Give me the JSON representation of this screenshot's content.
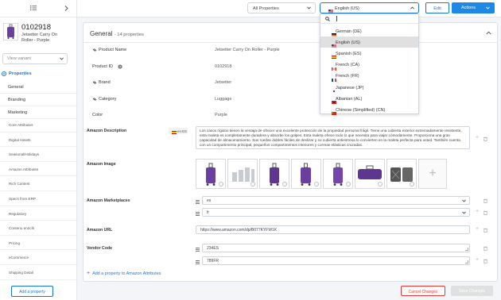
{
  "product": {
    "id": "0102918",
    "name": "Jetsetter Carry On Roller - Purple"
  },
  "sidebar": {
    "variant_placeholder": "View variant",
    "properties_heading": "Properties",
    "groups": [
      "General",
      "Branding",
      "Marketing"
    ],
    "subitems": [
      "Core Attributes",
      "Digital Assets",
      "Seasonal/Holidays",
      "Amazon Attributes",
      "Rich Content",
      "Specs from ERP",
      "Regulatory",
      "Contenu enrichi",
      "Pricing",
      "eCommerce",
      "Shipping Detail"
    ],
    "add_property_label": "Add a property"
  },
  "topbar": {
    "properties_filter": "All Properties",
    "language_selected": "English (US)",
    "edit_label": "Edit",
    "actions_label": "Actions"
  },
  "language_dropdown": {
    "options": [
      {
        "label": "German (DE)",
        "flag": "de"
      },
      {
        "label": "English (US)",
        "flag": "us"
      },
      {
        "label": "Spanish (ES)",
        "flag": "es"
      },
      {
        "label": "French (CA)",
        "flag": "ca"
      },
      {
        "label": "French (FR)",
        "flag": "fr"
      },
      {
        "label": "Japanese (JP)",
        "flag": "jp"
      },
      {
        "label": "Albanian (AL)",
        "flag": "al"
      },
      {
        "label": "Chinese (Simplified) (CN)",
        "flag": "cn"
      }
    ],
    "selected_index": 1
  },
  "card": {
    "title": "General",
    "count": "- 14 properties",
    "fields": {
      "product_name_label": "Product Name",
      "product_name_value": "Jetsetter Carry On Roller - Purple",
      "product_id_label": "Product ID",
      "product_id_value": "0102918",
      "brand_label": "Brand",
      "brand_value": "Jetsetter",
      "category_label": "Category",
      "category_value": "Luggage",
      "color_label": "Color",
      "color_value": "Purple",
      "amazon_description_label": "Amazon Description",
      "description_lang": "es-ES",
      "amazon_description_value": "Los casos rígidos tienen la ventaja de ofrecer una excelente protección de la propiedad personal frágil. Tiene una cubierta exterior extremadamente resistente, esta maleta es completamente duradera y absorbe los golpes. Esta maleta ofrece todo lo que necesita para viajar cómodamente. Proporciona una gran capacidad de almacenamiento. Sus ruedas dobles fáciles de deslizar y su cubierta antiestresa lo convierten en la maleta perfecta para usted. También cuenta con un compartimento principal, pequeños compartimentos interiores y correas elásticas cruzadas.",
      "amazon_image_label": "Amazon Image",
      "amazon_marketplaces_label": "Amazon Marketplaces",
      "marketplaces": [
        "es",
        "fr"
      ],
      "amazon_url_label": "Amazon URL",
      "amazon_url_value": "https://www.amazon.com/dp/B077KYFW1K",
      "vendor_code_label": "Vendor Code",
      "vendor_codes": [
        "234ES",
        "789FR"
      ]
    },
    "add_amazon_label": "Add a property to Amazon Attributes"
  },
  "footer": {
    "cancel_label": "Cancel Changes",
    "save_label": "Save Changes"
  },
  "colors": {
    "accent": "#1976d2",
    "danger": "#e53935",
    "luggage_purple": "#6b3fa0"
  }
}
